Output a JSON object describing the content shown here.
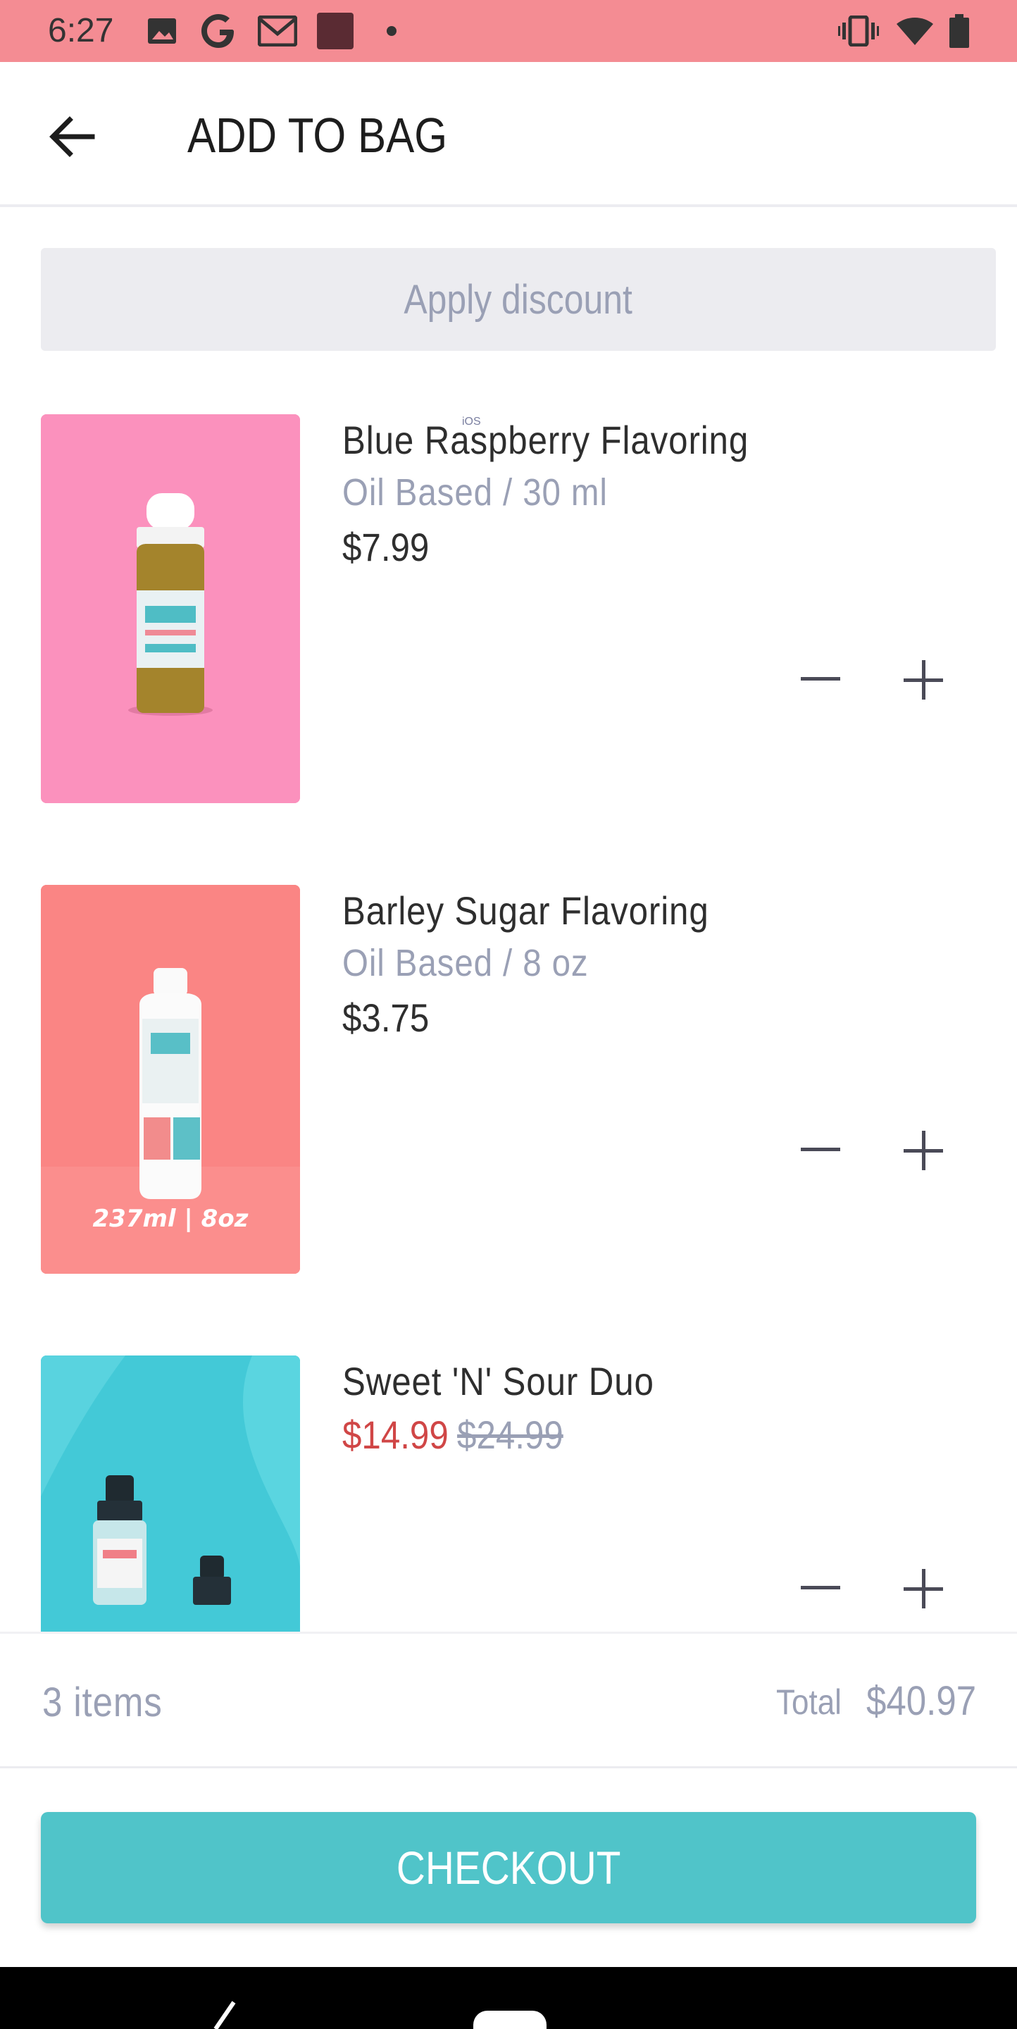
{
  "status_bar": {
    "time": "6:27",
    "icons": [
      "image-icon",
      "google-icon",
      "gmail-icon",
      "app-icon",
      "dot-icon",
      "vibrate-icon",
      "wifi-icon",
      "battery-icon"
    ],
    "color": "#f48c93"
  },
  "header": {
    "title": "ADD TO BAG",
    "back_icon": "arrow-left-icon"
  },
  "discount": {
    "label": "Apply discount"
  },
  "items": [
    {
      "name": "Blue Raspberry Flavoring",
      "variant": "Oil Based / 30 ml",
      "price": "$7.99",
      "tag": "iOS",
      "thumb_color": "#f98bb6"
    },
    {
      "name": "Barley Sugar Flavoring",
      "variant": "Oil Based / 8 oz",
      "price": "$3.75",
      "thumb_caption": "237ml | 8oz",
      "thumb_color": "#f97f7f"
    },
    {
      "name": "Sweet 'N' Sour Duo",
      "sale_price": "$14.99",
      "original_price": "$24.99",
      "thumb_color": "#3fcbd8"
    }
  ],
  "summary": {
    "count": "3 items",
    "total_label": "Total",
    "total_value": "$40.97"
  },
  "checkout": {
    "label": "CHECKOUT",
    "color": "#50c4c9"
  },
  "colors": {
    "sale_red": "#d04646",
    "muted": "#9aa0b5"
  }
}
